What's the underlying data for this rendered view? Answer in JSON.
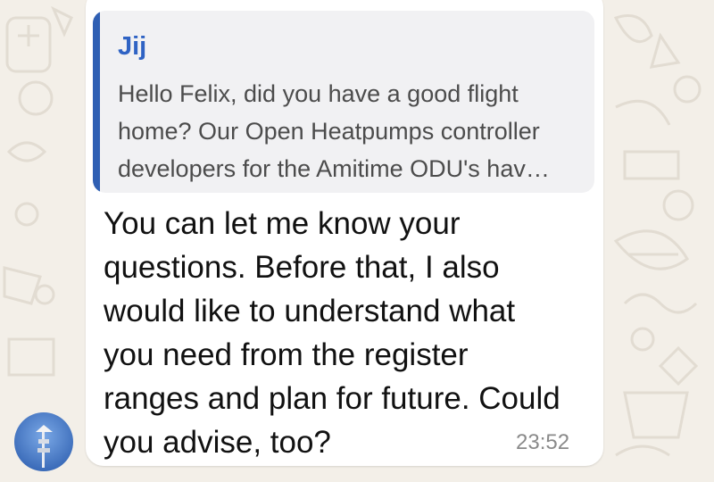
{
  "chat": {
    "wallpaper_color": "#f3efe8",
    "message": {
      "quote": {
        "author": "Jij",
        "accent_color": "#2f63c4",
        "lines": [
          "Hello Felix, did you have a good flight",
          "home? Our Open Heatpumps controller",
          "developers for the Amitime ODU's hav…"
        ]
      },
      "text_lines": [
        "You can let me know your",
        "questions. Before that, I also",
        "would like to understand what",
        "you need from the register",
        "ranges and plan for future. Could",
        "you advise, too?"
      ],
      "time": "23:52"
    },
    "avatar": {
      "icon": "contact-photo-icon"
    }
  }
}
